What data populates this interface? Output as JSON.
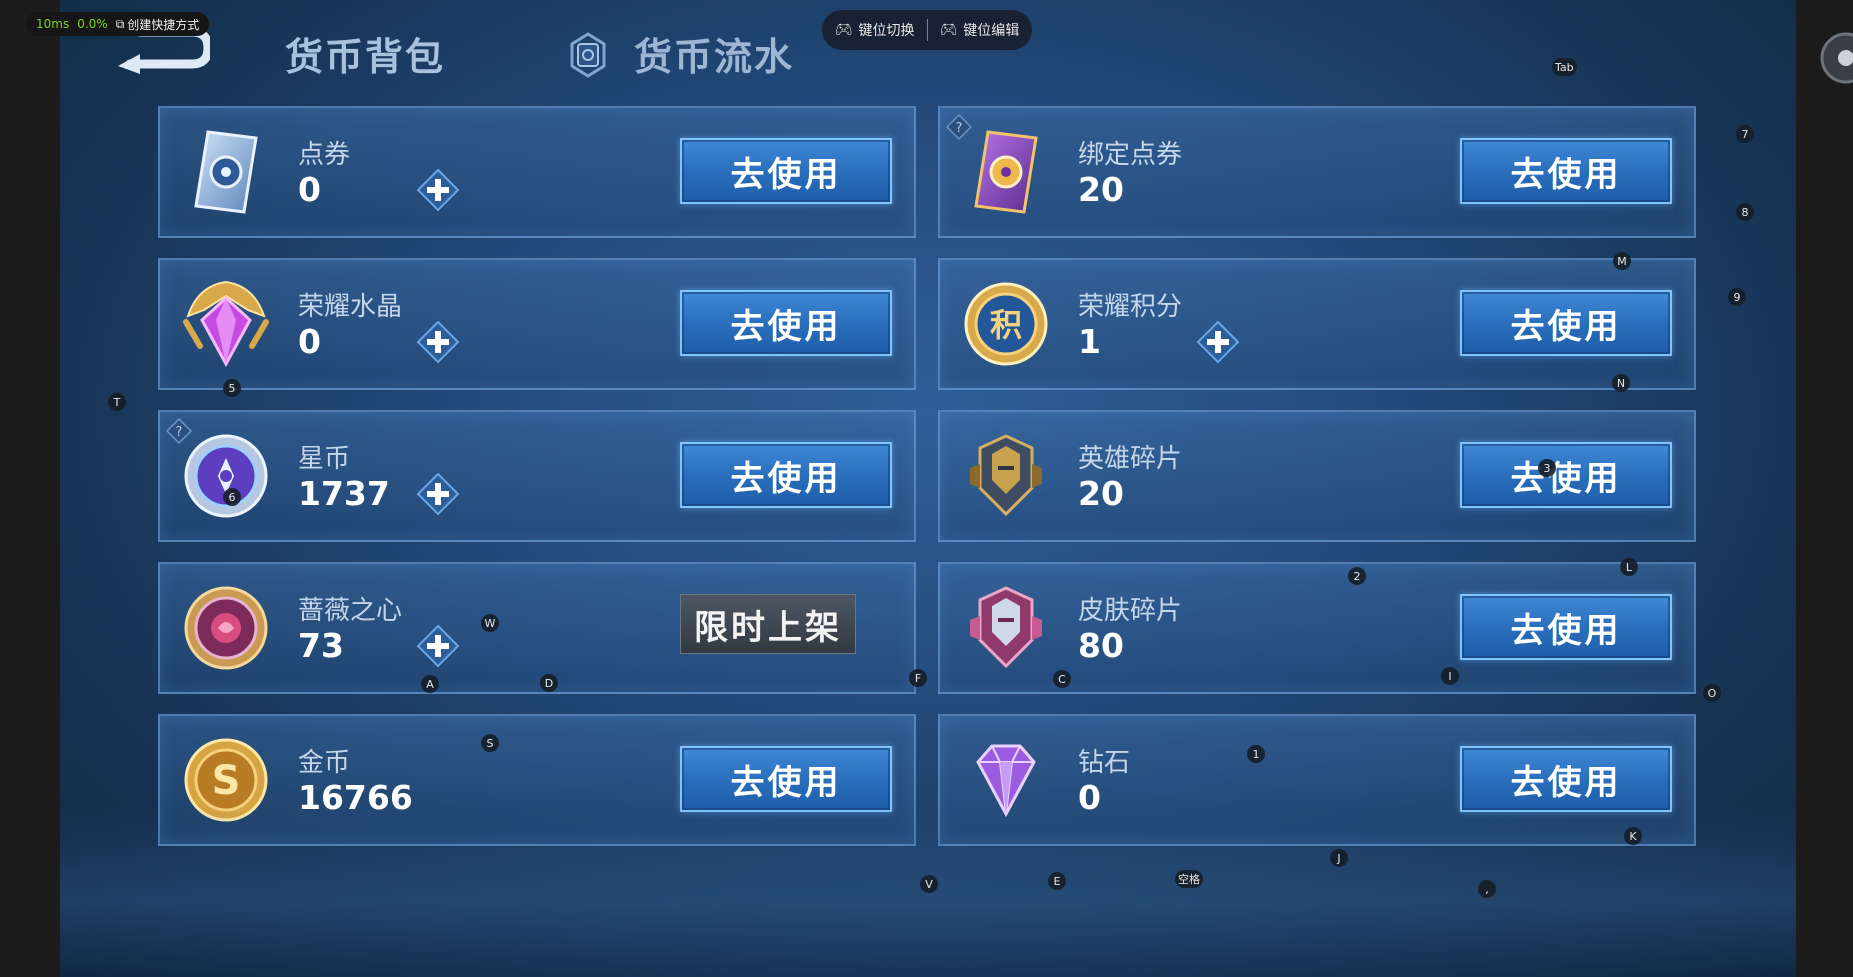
{
  "overlay": {
    "latency": "10ms",
    "loss": "0.0%",
    "shortcut_label": "创建快捷方式",
    "key_switch": "键位切换",
    "key_edit": "键位编辑"
  },
  "header": {
    "tab_bag": "货币背包",
    "tab_flow": "货币流水"
  },
  "action_label": "去使用",
  "limited_label": "限时上架",
  "currencies": [
    {
      "name": "点券",
      "value": "0"
    },
    {
      "name": "绑定点券",
      "value": "20"
    },
    {
      "name": "荣耀水晶",
      "value": "0"
    },
    {
      "name": "荣耀积分",
      "value": "1"
    },
    {
      "name": "星币",
      "value": "1737"
    },
    {
      "name": "英雄碎片",
      "value": "20"
    },
    {
      "name": "蔷薇之心",
      "value": "73"
    },
    {
      "name": "皮肤碎片",
      "value": "80"
    },
    {
      "name": "金币",
      "value": "16766"
    },
    {
      "name": "钻石",
      "value": "0"
    }
  ],
  "key_hints": [
    "Tab",
    "7",
    "8",
    "M",
    "9",
    "5",
    "T",
    "N",
    "6",
    "3",
    "2",
    "L",
    "W",
    "F",
    "C",
    "I",
    "O",
    "A",
    "D",
    "S",
    "1",
    "J",
    "K",
    "V",
    "E",
    "空格",
    ","
  ],
  "icons": {
    "dianquan": "ticket-icon",
    "bound": "purple-ticket-icon",
    "crystal": "crystal-icon",
    "points": "points-medal-icon",
    "starcoin": "star-coin-icon",
    "hero": "hero-fragment-icon",
    "rose": "rose-heart-icon",
    "skin": "skin-fragment-icon",
    "gold": "gold-coin-icon",
    "diamond": "diamond-icon"
  }
}
